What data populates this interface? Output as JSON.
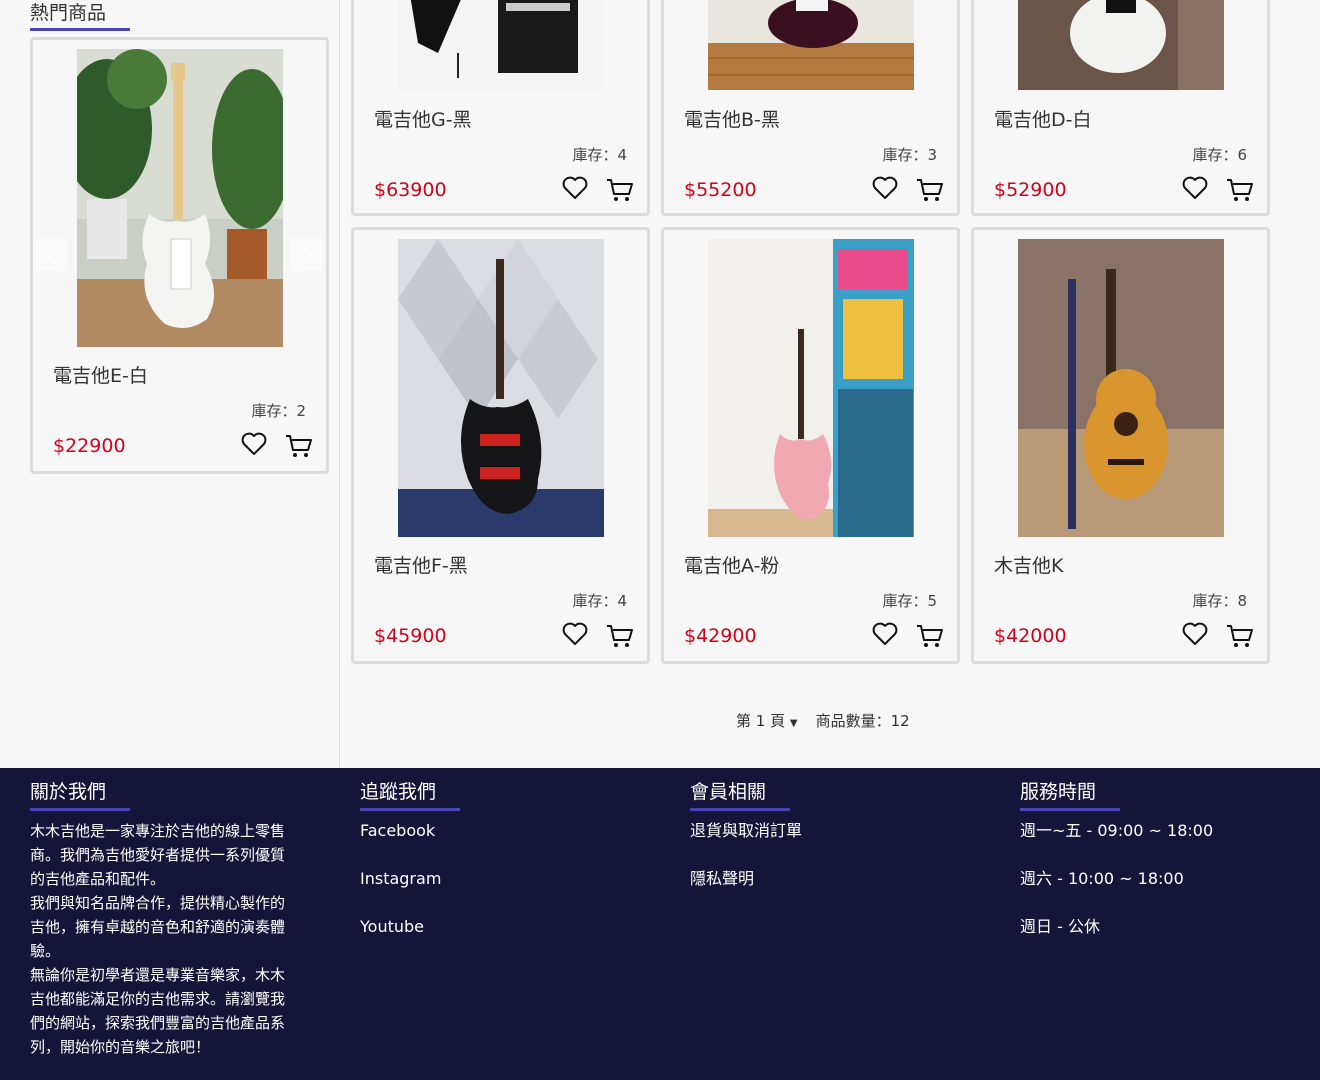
{
  "hot": {
    "title": "熱門商品",
    "product": {
      "name": "電吉他E-白",
      "stock": "庫存：2",
      "price": "$22900"
    }
  },
  "products": [
    {
      "name": "電吉他G-黑",
      "stock": "庫存：4",
      "price": "$63900"
    },
    {
      "name": "電吉他B-黑",
      "stock": "庫存：3",
      "price": "$55200"
    },
    {
      "name": "電吉他D-白",
      "stock": "庫存：6",
      "price": "$52900"
    },
    {
      "name": "電吉他F-黑",
      "stock": "庫存：4",
      "price": "$45900"
    },
    {
      "name": "電吉他A-粉",
      "stock": "庫存：5",
      "price": "$42900"
    },
    {
      "name": "木吉他K",
      "stock": "庫存：8",
      "price": "$42000"
    }
  ],
  "pager": {
    "page_label": "第 1 頁",
    "count_label": "商品數量：12"
  },
  "footer": {
    "about": {
      "title": "關於我們",
      "p1": "木木吉他是一家專注於吉他的線上零售商。我們為吉他愛好者提供一系列優質的吉他產品和配件。",
      "p2": "我們與知名品牌合作，提供精心製作的吉他，擁有卓越的音色和舒適的演奏體驗。",
      "p3": "無論你是初學者還是專業音樂家，木木吉他都能滿足你的吉他需求。請瀏覽我們的網站，探索我們豐富的吉他產品系列，開始你的音樂之旅吧！"
    },
    "follow": {
      "title": "追蹤我們",
      "links": [
        "Facebook",
        "Instagram",
        "Youtube"
      ]
    },
    "member": {
      "title": "會員相關",
      "links": [
        "退貨與取消訂單",
        "隱私聲明"
      ]
    },
    "hours": {
      "title": "服務時間",
      "lines": [
        "週一~五 - 09:00 ~ 18:00",
        "週六 - 10:00 ~ 18:00",
        "週日 - 公休"
      ]
    }
  },
  "colors": {
    "accent": "#4a45b5",
    "price": "#d0021b",
    "footer_bg": "#15153a"
  }
}
